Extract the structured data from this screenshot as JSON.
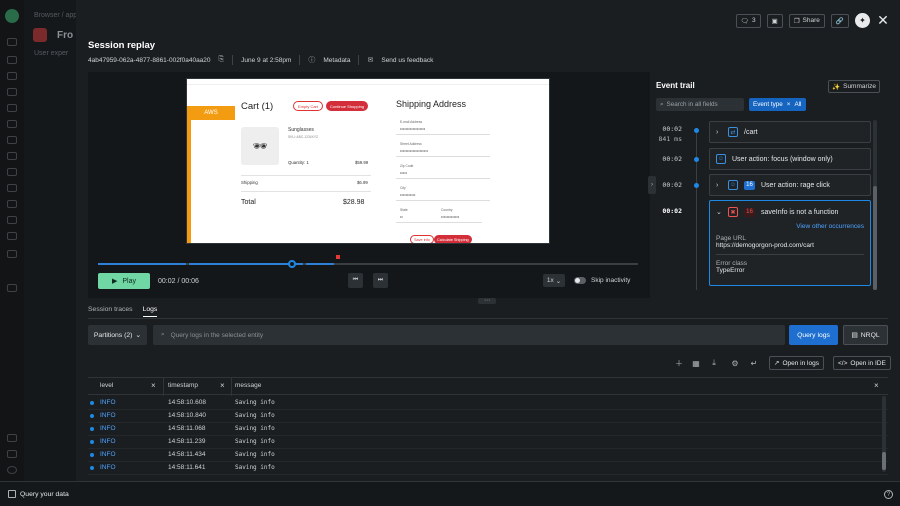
{
  "background": {
    "breadcrumb": "Browser / app",
    "app_title": "Fro",
    "subtitle": "User exper"
  },
  "header": {
    "comments_count": "3",
    "share_label": "Share",
    "title": "Session replay",
    "session_id": "4ab47959-062a-4877-8861-002f0a40aa20",
    "date": "June 9 at 2:58pm",
    "metadata_label": "Metadata",
    "feedback_label": "Send us feedback"
  },
  "replay": {
    "aws_badge": "AWS",
    "cart_title": "Cart (1)",
    "empty_cart": "Empty Cart",
    "continue_shopping": "Continue Shopping",
    "product_name": "Sunglasses",
    "product_sku": "SKU: ABC-1234XYZ",
    "quantity": "Quantity: 1",
    "product_price": "$59.99",
    "shipping_label": "Shipping",
    "shipping_price": "$6.99",
    "total_label": "Total",
    "total_value": "$28.98",
    "shipping_title": "Shipping Address",
    "fields": [
      {
        "label": "E-mail Address",
        "value": "••••••••••••••••••"
      },
      {
        "label": "Street Address",
        "value": "••••••••••••••••••••"
      },
      {
        "label": "Zip Code",
        "value": "•••••"
      },
      {
        "label": "City",
        "value": "•••••••••••"
      }
    ],
    "state_label": "State",
    "state_value": "••",
    "country_label": "Country",
    "country_value": "•••••••••••••",
    "save_info": "Save info",
    "calculate_shipping": "Calculate Shipping",
    "play_label": "Play",
    "time": "00:02 / 00:06",
    "speed": "1x",
    "skip_inactivity": "Skip inactivity",
    "progress_fraction": 0.36
  },
  "event_trail": {
    "title": "Event trail",
    "summarize_label": "Summarize",
    "search_placeholder": "Search in all fields",
    "filter_label": "Event type",
    "filter_value": "All",
    "events": [
      {
        "time": "00:02",
        "duration": "841 ms",
        "label": "/cart",
        "badge": ""
      },
      {
        "time": "00:02",
        "duration": "",
        "label": "User action: focus (window only)",
        "badge": ""
      },
      {
        "time": "00:02",
        "duration": "",
        "label": "User action: rage click",
        "badge": "16"
      },
      {
        "time": "00:02",
        "duration": "",
        "label": "saveInfo is not a function",
        "badge": "16"
      }
    ],
    "expanded": {
      "view_other": "View other occurrences",
      "page_url_label": "Page URL",
      "page_url_value": "https://demogorgon-prod.com/cart",
      "error_class_label": "Error class",
      "error_class_value": "TypeError"
    }
  },
  "tabs": [
    "Session traces",
    "Logs"
  ],
  "logs": {
    "partitions_label": "Partitions (2)",
    "search_placeholder": "Query logs in the selected entity",
    "query_button": "Query logs",
    "nrql_button": "NRQL",
    "open_in_logs": "Open in logs",
    "open_in_ide": "Open in IDE",
    "columns": [
      "level",
      "timestamp",
      "message"
    ],
    "rows": [
      {
        "level": "INFO",
        "timestamp": "14:58:10.608",
        "message": "Saving info"
      },
      {
        "level": "INFO",
        "timestamp": "14:58:10.840",
        "message": "Saving info"
      },
      {
        "level": "INFO",
        "timestamp": "14:58:11.068",
        "message": "Saving info"
      },
      {
        "level": "INFO",
        "timestamp": "14:58:11.239",
        "message": "Saving info"
      },
      {
        "level": "INFO",
        "timestamp": "14:58:11.434",
        "message": "Saving info"
      },
      {
        "level": "INFO",
        "timestamp": "14:58:11.641",
        "message": "Saving info"
      }
    ]
  },
  "footer": {
    "query_label": "Query your data"
  },
  "colors": {
    "accent_blue": "#1e6fd0",
    "play_green": "#6fd6a4",
    "error_red": "#f05252",
    "aws_orange": "#f39c12"
  }
}
